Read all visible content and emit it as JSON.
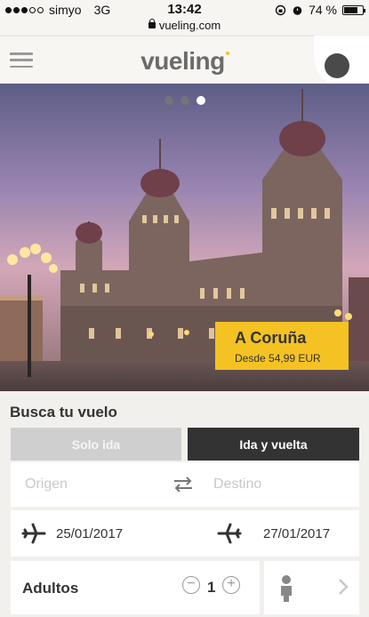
{
  "status": {
    "carrier": "simyo",
    "network": "3G",
    "time": "13:42",
    "battery": "74 %",
    "battery_level": 0.74
  },
  "browser": {
    "url": "vueling.com"
  },
  "header": {
    "logo": "vueling"
  },
  "hero": {
    "slides": [
      {
        "active": false
      },
      {
        "active": false
      },
      {
        "active": true
      }
    ],
    "promo": {
      "city": "A Coruña",
      "price": "Desde 54,99 EUR"
    }
  },
  "search": {
    "title": "Busca tu vuelo",
    "trip_one_way": "Solo ida",
    "trip_round": "Ida y vuelta",
    "origin_placeholder": "Origen",
    "destination_placeholder": "Destino",
    "date_out": "25/01/2017",
    "date_return": "27/01/2017",
    "adults_label": "Adultos",
    "adults_count": "1",
    "minus": "−",
    "plus": "+"
  },
  "colors": {
    "brand_yellow": "#f4c223",
    "dark": "#333333",
    "inactive": "#cfcfcf",
    "background": "#f1f0ec"
  }
}
